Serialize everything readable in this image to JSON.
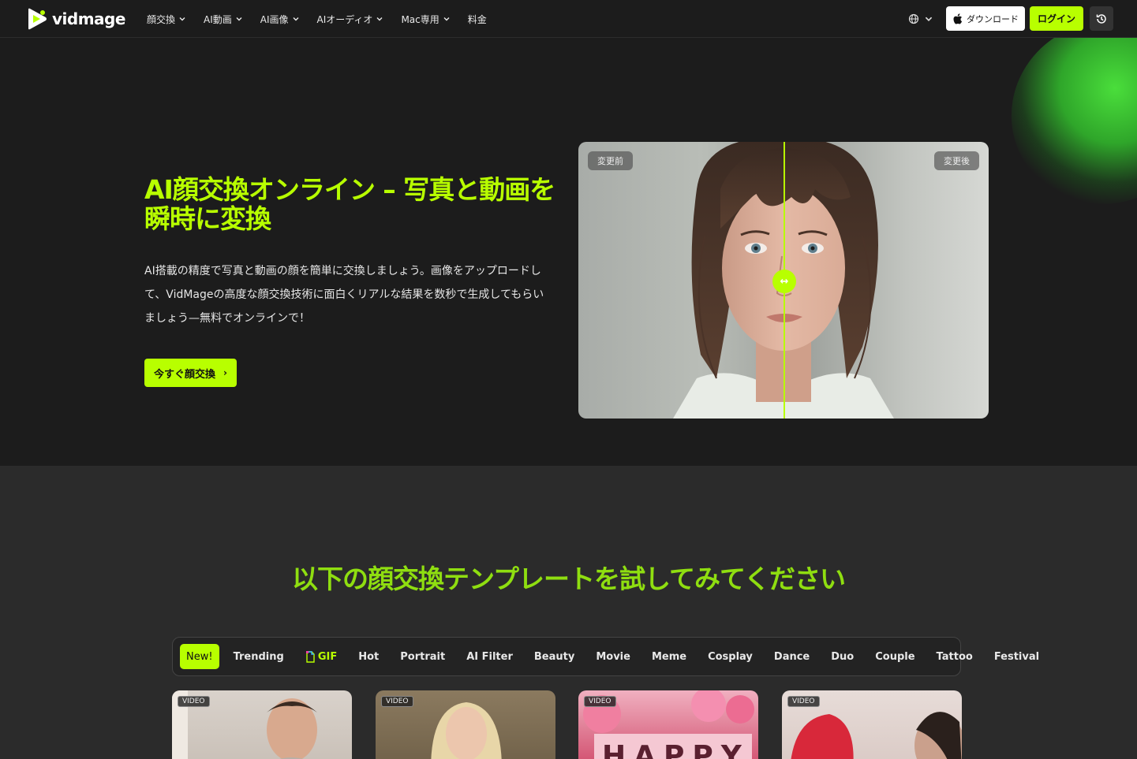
{
  "nav": {
    "logo_text": "vidmage",
    "menu": [
      {
        "label": "顔交換",
        "has_dropdown": true
      },
      {
        "label": "AI動画",
        "has_dropdown": true
      },
      {
        "label": "AI画像",
        "has_dropdown": true
      },
      {
        "label": "AIオーディオ",
        "has_dropdown": true
      },
      {
        "label": "Mac専用",
        "has_dropdown": true
      },
      {
        "label": "料金",
        "has_dropdown": false
      }
    ],
    "download_label": "ダウンロード",
    "login_label": "ログイン"
  },
  "hero": {
    "title": "AI顔交換オンライン – 写真と動画を瞬時に変換",
    "description": "AI搭載の精度で写真と動画の顔を簡単に交換しましょう。画像をアップロードして、VidMageの高度な顔交換技術に面白くリアルな結果を数秒で生成してもらいましょう—無料でオンラインで！",
    "cta_label": "今すぐ顔交換",
    "cta_arrow": "›",
    "compare": {
      "before_label": "変更前",
      "after_label": "変更後",
      "handle_glyph": "↔"
    }
  },
  "templates": {
    "title": "以下の顔交換テンプレートを試してみてください",
    "tabs": [
      "New!",
      "Trending",
      "GIF",
      "Hot",
      "Portrait",
      "AI Filter",
      "Beauty",
      "Movie",
      "Meme",
      "Cosplay",
      "Dance",
      "Duo",
      "Couple",
      "Tattoo",
      "Festival"
    ],
    "active_tab": "New!",
    "card_badge": "VIDEO"
  },
  "colors": {
    "accent": "#b8ff00",
    "title_green": "#8fde10",
    "background": "#1c1c1c",
    "section_bg": "#2b2b2b"
  }
}
